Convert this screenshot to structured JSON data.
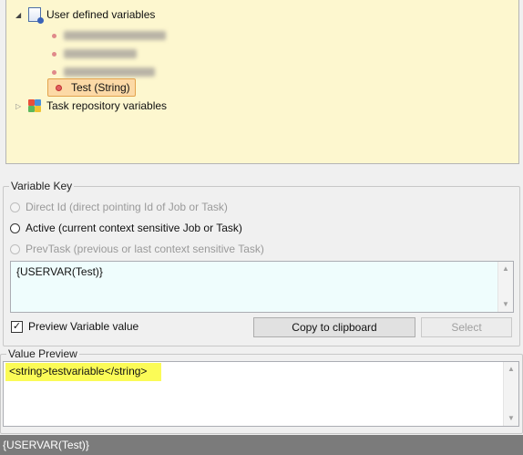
{
  "tree": {
    "user_defined_label": "User defined variables",
    "selected_item_label": "Test (String)",
    "task_repository_label": "Task repository variables"
  },
  "variable_key": {
    "group_title": "Variable Key",
    "options": [
      {
        "label": "Direct Id (direct pointing Id of Job or Task)",
        "enabled": false,
        "selected": false
      },
      {
        "label": "Active (current context sensitive Job or Task)",
        "enabled": true,
        "selected": false
      },
      {
        "label": "PrevTask (previous or last context sensitive Task)",
        "enabled": false,
        "selected": false
      }
    ],
    "key_value": "{USERVAR(Test)}",
    "preview_checkbox_label": "Preview Variable value",
    "preview_checked": true,
    "copy_button_label": "Copy to clipboard",
    "select_button_label": "Select"
  },
  "value_preview": {
    "group_title": "Value Preview",
    "value": "<string>testvariable</string>",
    "highlight_color": "#fbfb57"
  },
  "statusbar": {
    "text": "{USERVAR(Test)}"
  },
  "colors": {
    "tree_background": "#fdf7cf",
    "selection": "#fcd9a6",
    "key_background": "#effdfd",
    "statusbar": "#7b7b7b"
  }
}
